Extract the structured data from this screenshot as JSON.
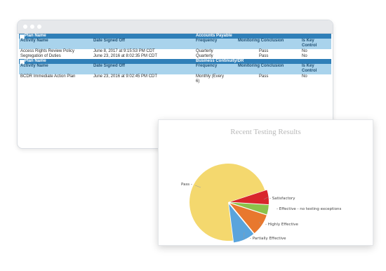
{
  "window": {
    "title": ""
  },
  "table": {
    "sections": [
      {
        "plan_label": "Plan Name",
        "plan_value": "Accounts Payable",
        "headers": [
          "Activity Name",
          "Date Signed Off",
          "Frequency",
          "Monitoring Conclusion",
          "Is Key Control"
        ],
        "rows": [
          [
            "Access Rights Review Policy",
            "June 8, 2017 at 9:15:53 PM CDT",
            "Quarterly",
            "Pass",
            "No"
          ],
          [
            "Segregation of Duties",
            "June 23, 2016 at 8:02:35 PM CDT",
            "Quarterly",
            "Pass",
            "No"
          ]
        ]
      },
      {
        "plan_label": "Plan Name",
        "plan_value": "Business Continuity/DR",
        "headers": [
          "Activity Name",
          "Date Signed Off",
          "Frequency",
          "Monitoring Conclusion",
          "Is Key Control"
        ],
        "rows": [
          [
            "BCDR Immediate Action Plan",
            "June 23, 2016 at 9:02:45 PM CDT",
            "Monthly (Every 6)",
            "Pass",
            "No"
          ]
        ]
      }
    ]
  },
  "chart_data": {
    "type": "pie",
    "title": "Recent Testing Results",
    "slices": [
      {
        "label": "Pass",
        "value": 72,
        "color": "#f4d86e"
      },
      {
        "label": "Satisfactory",
        "value": 6,
        "color": "#d9262c"
      },
      {
        "label": "Effective - no testing exceptions",
        "value": 4,
        "color": "#8bc34a"
      },
      {
        "label": "Highly Effective",
        "value": 9,
        "color": "#e8782e"
      },
      {
        "label": "Partially Effective",
        "value": 9,
        "color": "#5aa4dc"
      }
    ]
  }
}
